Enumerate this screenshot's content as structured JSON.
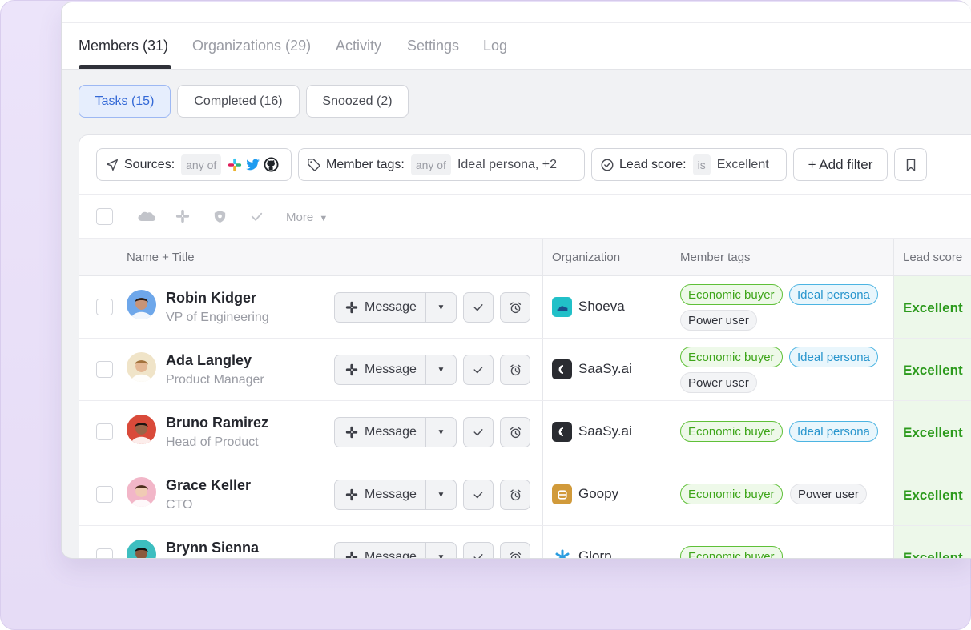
{
  "tabs": [
    {
      "label": "Members (31)",
      "active": true
    },
    {
      "label": "Organizations (29)",
      "active": false
    },
    {
      "label": "Activity",
      "active": false
    },
    {
      "label": "Settings",
      "active": false
    },
    {
      "label": "Log",
      "active": false
    }
  ],
  "segments": [
    {
      "label": "Tasks (15)",
      "active": true
    },
    {
      "label": "Completed (16)",
      "active": false
    },
    {
      "label": "Snoozed (2)",
      "active": false
    }
  ],
  "filters": {
    "sources": {
      "label": "Sources:",
      "op": "any of",
      "icons": [
        "slack-icon",
        "twitter-icon",
        "github-icon"
      ]
    },
    "member_tags": {
      "label": "Member tags:",
      "op": "any of",
      "value": "Ideal persona, +2"
    },
    "lead_score": {
      "label": "Lead score:",
      "op": "is",
      "value": "Excellent"
    },
    "add_filter": "+ Add filter"
  },
  "actions": {
    "more": "More"
  },
  "columns": {
    "name": "Name + Title",
    "org": "Organization",
    "tags": "Member tags",
    "lead": "Lead score"
  },
  "button_labels": {
    "message": "Message"
  },
  "rows": [
    {
      "name": "Robin Kidger",
      "title": "VP of Engineering",
      "org": "Shoeva",
      "tags": [
        "Economic buyer",
        "Ideal persona",
        "Power user"
      ],
      "lead": "Excellent"
    },
    {
      "name": "Ada Langley",
      "title": "Product Manager",
      "org": "SaaSy.ai",
      "tags": [
        "Economic buyer",
        "Ideal persona",
        "Power user"
      ],
      "lead": "Excellent"
    },
    {
      "name": "Bruno Ramirez",
      "title": "Head of Product",
      "org": "SaaSy.ai",
      "tags": [
        "Economic buyer",
        "Ideal persona"
      ],
      "lead": "Excellent"
    },
    {
      "name": "Grace Keller",
      "title": "CTO",
      "org": "Goopy",
      "tags": [
        "Economic buyer",
        "Power user"
      ],
      "lead": "Excellent"
    },
    {
      "name": "Brynn Sienna",
      "title": "",
      "org": "Glorp",
      "tags": [
        "Economic buyer"
      ],
      "lead": "Excellent"
    }
  ],
  "colors": {
    "accent_blue": "#3469d6",
    "tag_green": "#3ea51a",
    "tag_blue": "#2895cd",
    "lead_green": "#2c9a1c"
  }
}
